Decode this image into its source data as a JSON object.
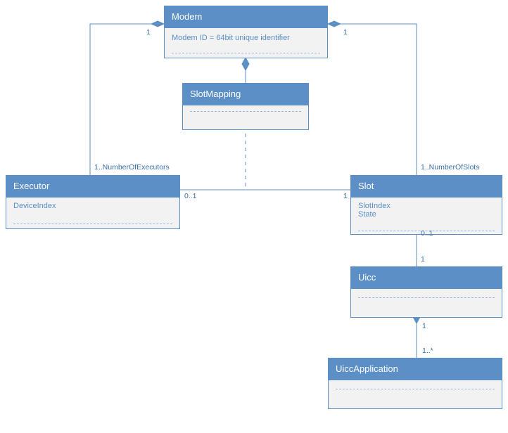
{
  "classes": {
    "modem": {
      "name": "Modem",
      "attrs": [
        "Modem ID = 64bit unique identifier"
      ]
    },
    "slotmapping": {
      "name": "SlotMapping",
      "attrs": []
    },
    "executor": {
      "name": "Executor",
      "attrs": [
        "DeviceIndex"
      ]
    },
    "slot": {
      "name": "Slot",
      "attrs": [
        "SlotIndex",
        "State"
      ]
    },
    "uicc": {
      "name": "Uicc",
      "attrs": []
    },
    "uiccapp": {
      "name": "UiccApplication",
      "attrs": []
    }
  },
  "mult": {
    "m1": "1",
    "modem_exec": "1..NumberOfExecutors",
    "modem_slot": "1..NumberOfSlots",
    "exec_slot_left": "0..1",
    "exec_slot_right": "1",
    "slot_uicc_top": "0..1",
    "slot_uicc_bot": "1",
    "uicc_app_top": "1",
    "uicc_app_bot": "1..*"
  }
}
